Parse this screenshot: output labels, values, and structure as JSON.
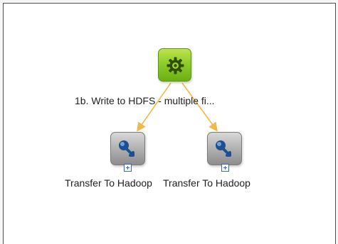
{
  "flow": {
    "root": {
      "label": "1b. Write to HDFS - multiple fi...",
      "icon": "gear-icon",
      "color": "#8fcd29"
    },
    "children": [
      {
        "label": "Transfer To Hadoop",
        "icon": "transfer-arrow-icon",
        "expand_icon": "plus-icon"
      },
      {
        "label": "Transfer To Hadoop",
        "icon": "transfer-arrow-icon",
        "expand_icon": "plus-icon"
      }
    ],
    "link_color": "#f0b94a"
  }
}
